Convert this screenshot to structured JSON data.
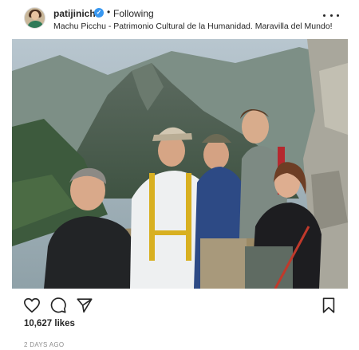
{
  "post": {
    "username": "patijinich",
    "verified_icon": "verified-badge-icon",
    "follow_state": "Following",
    "separator": "•",
    "caption": "Machu Picchu - Patrimonio Cultural de la Humanidad. Maravilla del Mundo!",
    "likes": "10,627 likes",
    "time_ago": "2 DAYS AGO"
  },
  "icons": {
    "more": "more-options-icon",
    "like": "heart-icon",
    "comment": "comment-bubble-icon",
    "share": "paper-plane-icon",
    "save": "bookmark-icon"
  },
  "colors": {
    "verified": "#3897f0",
    "text": "#262626",
    "muted": "#8e8e8e"
  }
}
